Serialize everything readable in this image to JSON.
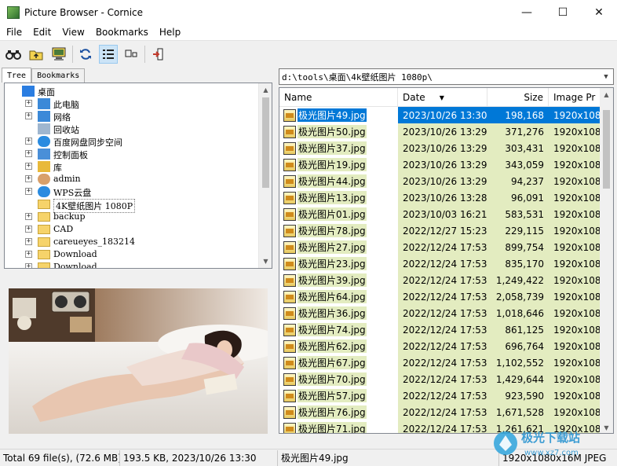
{
  "window": {
    "title": "Picture Browser - Cornice",
    "minimize": "—",
    "maximize": "☐",
    "close": "✕"
  },
  "menu": [
    "File",
    "Edit",
    "View",
    "Bookmarks",
    "Help"
  ],
  "toolbar": {
    "icons": [
      "binoculars-icon",
      "folder-up-icon",
      "monitor-slideshow-icon",
      "refresh-icon",
      "details-view-icon",
      "thumbnails-view-icon",
      "exit-icon"
    ]
  },
  "tabs": [
    "Tree",
    "Bookmarks"
  ],
  "tree": {
    "items": [
      {
        "label": "桌面",
        "icon": "desktop-icon"
      },
      {
        "label": "此电脑",
        "icon": "computer-icon"
      },
      {
        "label": "网络",
        "icon": "network-icon"
      },
      {
        "label": "回收站",
        "icon": "recycle-bin-icon"
      },
      {
        "label": "百度网盘同步空间",
        "icon": "baidu-sync-icon"
      },
      {
        "label": "控制面板",
        "icon": "control-panel-icon"
      },
      {
        "label": "库",
        "icon": "library-icon"
      },
      {
        "label": "admin",
        "icon": "user-icon"
      },
      {
        "label": "WPS云盘",
        "icon": "cloud-icon"
      },
      {
        "label": "4K壁纸图片 1080P",
        "icon": "folder-icon"
      },
      {
        "label": "backup",
        "icon": "folder-icon"
      },
      {
        "label": "CAD",
        "icon": "folder-icon"
      },
      {
        "label": "careueyes_183214",
        "icon": "folder-icon"
      },
      {
        "label": "Download",
        "icon": "folder-icon"
      },
      {
        "label": "Download",
        "icon": "folder-icon"
      }
    ]
  },
  "path": "d:\\tools\\桌面\\4k壁纸图片 1080p\\",
  "filelist": {
    "columns": {
      "name": "Name",
      "date": "Date",
      "size": "Size",
      "dims": "Image Pr"
    },
    "rows": [
      {
        "name": "极光图片49.jpg",
        "date": "2023/10/26 13:30",
        "size": "198,168",
        "dims": "1920x108"
      },
      {
        "name": "极光图片50.jpg",
        "date": "2023/10/26 13:29",
        "size": "371,276",
        "dims": "1920x108"
      },
      {
        "name": "极光图片37.jpg",
        "date": "2023/10/26 13:29",
        "size": "303,431",
        "dims": "1920x108"
      },
      {
        "name": "极光图片19.jpg",
        "date": "2023/10/26 13:29",
        "size": "343,059",
        "dims": "1920x108"
      },
      {
        "name": "极光图片44.jpg",
        "date": "2023/10/26 13:29",
        "size": "94,237",
        "dims": "1920x108"
      },
      {
        "name": "极光图片13.jpg",
        "date": "2023/10/26 13:28",
        "size": "96,091",
        "dims": "1920x108"
      },
      {
        "name": "极光图片01.jpg",
        "date": "2023/10/03 16:21",
        "size": "583,531",
        "dims": "1920x108"
      },
      {
        "name": "极光图片78.jpg",
        "date": "2022/12/27 15:23",
        "size": "229,115",
        "dims": "1920x108"
      },
      {
        "name": "极光图片27.jpg",
        "date": "2022/12/24 17:53",
        "size": "899,754",
        "dims": "1920x108"
      },
      {
        "name": "极光图片23.jpg",
        "date": "2022/12/24 17:53",
        "size": "835,170",
        "dims": "1920x108"
      },
      {
        "name": "极光图片39.jpg",
        "date": "2022/12/24 17:53",
        "size": "1,249,422",
        "dims": "1920x108"
      },
      {
        "name": "极光图片64.jpg",
        "date": "2022/12/24 17:53",
        "size": "2,058,739",
        "dims": "1920x108"
      },
      {
        "name": "极光图片36.jpg",
        "date": "2022/12/24 17:53",
        "size": "1,018,646",
        "dims": "1920x108"
      },
      {
        "name": "极光图片74.jpg",
        "date": "2022/12/24 17:53",
        "size": "861,125",
        "dims": "1920x108"
      },
      {
        "name": "极光图片62.jpg",
        "date": "2022/12/24 17:53",
        "size": "696,764",
        "dims": "1920x108"
      },
      {
        "name": "极光图片67.jpg",
        "date": "2022/12/24 17:53",
        "size": "1,102,552",
        "dims": "1920x108"
      },
      {
        "name": "极光图片70.jpg",
        "date": "2022/12/24 17:53",
        "size": "1,429,644",
        "dims": "1920x108"
      },
      {
        "name": "极光图片57.jpg",
        "date": "2022/12/24 17:53",
        "size": "923,590",
        "dims": "1920x108"
      },
      {
        "name": "极光图片76.jpg",
        "date": "2022/12/24 17:53",
        "size": "1,671,528",
        "dims": "1920x108"
      },
      {
        "name": "极光图片71.jpg",
        "date": "2022/12/24 17:53",
        "size": "1,261,621",
        "dims": "1920x108"
      }
    ]
  },
  "status": {
    "total": "Total 69 file(s), (72.6 MB)",
    "selected_info": "193.5 KB, 2023/10/26 13:30",
    "selected_name": "极光图片49.jpg",
    "image_info": "1920x1080x16M JPEG"
  },
  "colors": {
    "selection": "#0078d7",
    "row_highlight": "#e3ecc0",
    "toolbar_active": "#cce4f7"
  }
}
